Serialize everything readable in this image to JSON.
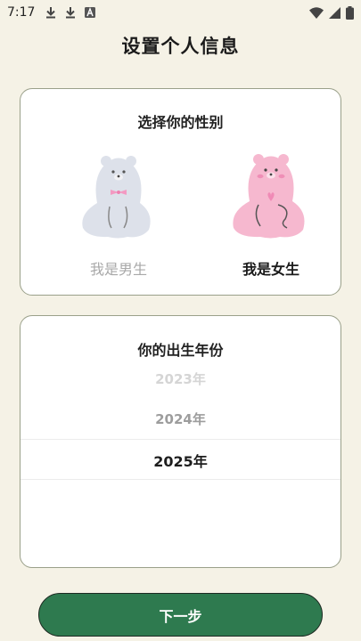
{
  "status_bar": {
    "time": "7:17",
    "left_icons": [
      "download-icon",
      "download-icon",
      "font-a-icon"
    ],
    "right_icons": [
      "wifi-icon",
      "cellular-signal-icon",
      "battery-icon"
    ]
  },
  "page": {
    "title": "设置个人信息"
  },
  "gender": {
    "heading": "选择你的性别",
    "options": [
      {
        "label": "我是男生",
        "selected": false,
        "color": "#dde1ea",
        "accent": "#f39ac2"
      },
      {
        "label": "我是女生",
        "selected": true,
        "color": "#f6b8cf",
        "accent": "#f08ab6"
      }
    ]
  },
  "birth_year": {
    "heading": "你的出生年份",
    "years": [
      "2023年",
      "2024年",
      "2025年"
    ],
    "selected": "2025年"
  },
  "next_button": {
    "label": "下一步",
    "color": "#2e7a4f"
  },
  "colors": {
    "background": "#f5f2e6",
    "card": "#ffffff",
    "card_border": "#9aa08a"
  }
}
